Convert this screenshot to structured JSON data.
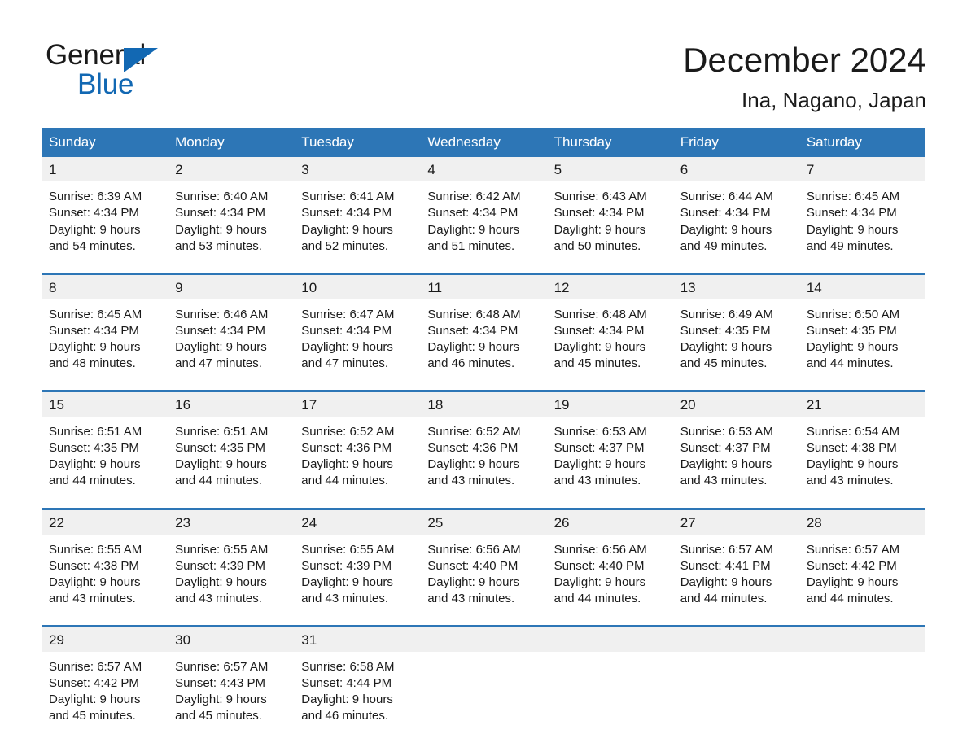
{
  "brand": {
    "name_part1": "General",
    "name_part2": "Blue",
    "accent_color": "#1268b3",
    "header_color": "#2d76b6"
  },
  "header": {
    "title": "December 2024",
    "subtitle": "Ina, Nagano, Japan"
  },
  "weekdays": [
    "Sunday",
    "Monday",
    "Tuesday",
    "Wednesday",
    "Thursday",
    "Friday",
    "Saturday"
  ],
  "weeks": [
    {
      "days": [
        {
          "num": "1",
          "sunrise": "Sunrise: 6:39 AM",
          "sunset": "Sunset: 4:34 PM",
          "daylight_line1": "Daylight: 9 hours",
          "daylight_line2": "and 54 minutes."
        },
        {
          "num": "2",
          "sunrise": "Sunrise: 6:40 AM",
          "sunset": "Sunset: 4:34 PM",
          "daylight_line1": "Daylight: 9 hours",
          "daylight_line2": "and 53 minutes."
        },
        {
          "num": "3",
          "sunrise": "Sunrise: 6:41 AM",
          "sunset": "Sunset: 4:34 PM",
          "daylight_line1": "Daylight: 9 hours",
          "daylight_line2": "and 52 minutes."
        },
        {
          "num": "4",
          "sunrise": "Sunrise: 6:42 AM",
          "sunset": "Sunset: 4:34 PM",
          "daylight_line1": "Daylight: 9 hours",
          "daylight_line2": "and 51 minutes."
        },
        {
          "num": "5",
          "sunrise": "Sunrise: 6:43 AM",
          "sunset": "Sunset: 4:34 PM",
          "daylight_line1": "Daylight: 9 hours",
          "daylight_line2": "and 50 minutes."
        },
        {
          "num": "6",
          "sunrise": "Sunrise: 6:44 AM",
          "sunset": "Sunset: 4:34 PM",
          "daylight_line1": "Daylight: 9 hours",
          "daylight_line2": "and 49 minutes."
        },
        {
          "num": "7",
          "sunrise": "Sunrise: 6:45 AM",
          "sunset": "Sunset: 4:34 PM",
          "daylight_line1": "Daylight: 9 hours",
          "daylight_line2": "and 49 minutes."
        }
      ]
    },
    {
      "days": [
        {
          "num": "8",
          "sunrise": "Sunrise: 6:45 AM",
          "sunset": "Sunset: 4:34 PM",
          "daylight_line1": "Daylight: 9 hours",
          "daylight_line2": "and 48 minutes."
        },
        {
          "num": "9",
          "sunrise": "Sunrise: 6:46 AM",
          "sunset": "Sunset: 4:34 PM",
          "daylight_line1": "Daylight: 9 hours",
          "daylight_line2": "and 47 minutes."
        },
        {
          "num": "10",
          "sunrise": "Sunrise: 6:47 AM",
          "sunset": "Sunset: 4:34 PM",
          "daylight_line1": "Daylight: 9 hours",
          "daylight_line2": "and 47 minutes."
        },
        {
          "num": "11",
          "sunrise": "Sunrise: 6:48 AM",
          "sunset": "Sunset: 4:34 PM",
          "daylight_line1": "Daylight: 9 hours",
          "daylight_line2": "and 46 minutes."
        },
        {
          "num": "12",
          "sunrise": "Sunrise: 6:48 AM",
          "sunset": "Sunset: 4:34 PM",
          "daylight_line1": "Daylight: 9 hours",
          "daylight_line2": "and 45 minutes."
        },
        {
          "num": "13",
          "sunrise": "Sunrise: 6:49 AM",
          "sunset": "Sunset: 4:35 PM",
          "daylight_line1": "Daylight: 9 hours",
          "daylight_line2": "and 45 minutes."
        },
        {
          "num": "14",
          "sunrise": "Sunrise: 6:50 AM",
          "sunset": "Sunset: 4:35 PM",
          "daylight_line1": "Daylight: 9 hours",
          "daylight_line2": "and 44 minutes."
        }
      ]
    },
    {
      "days": [
        {
          "num": "15",
          "sunrise": "Sunrise: 6:51 AM",
          "sunset": "Sunset: 4:35 PM",
          "daylight_line1": "Daylight: 9 hours",
          "daylight_line2": "and 44 minutes."
        },
        {
          "num": "16",
          "sunrise": "Sunrise: 6:51 AM",
          "sunset": "Sunset: 4:35 PM",
          "daylight_line1": "Daylight: 9 hours",
          "daylight_line2": "and 44 minutes."
        },
        {
          "num": "17",
          "sunrise": "Sunrise: 6:52 AM",
          "sunset": "Sunset: 4:36 PM",
          "daylight_line1": "Daylight: 9 hours",
          "daylight_line2": "and 44 minutes."
        },
        {
          "num": "18",
          "sunrise": "Sunrise: 6:52 AM",
          "sunset": "Sunset: 4:36 PM",
          "daylight_line1": "Daylight: 9 hours",
          "daylight_line2": "and 43 minutes."
        },
        {
          "num": "19",
          "sunrise": "Sunrise: 6:53 AM",
          "sunset": "Sunset: 4:37 PM",
          "daylight_line1": "Daylight: 9 hours",
          "daylight_line2": "and 43 minutes."
        },
        {
          "num": "20",
          "sunrise": "Sunrise: 6:53 AM",
          "sunset": "Sunset: 4:37 PM",
          "daylight_line1": "Daylight: 9 hours",
          "daylight_line2": "and 43 minutes."
        },
        {
          "num": "21",
          "sunrise": "Sunrise: 6:54 AM",
          "sunset": "Sunset: 4:38 PM",
          "daylight_line1": "Daylight: 9 hours",
          "daylight_line2": "and 43 minutes."
        }
      ]
    },
    {
      "days": [
        {
          "num": "22",
          "sunrise": "Sunrise: 6:55 AM",
          "sunset": "Sunset: 4:38 PM",
          "daylight_line1": "Daylight: 9 hours",
          "daylight_line2": "and 43 minutes."
        },
        {
          "num": "23",
          "sunrise": "Sunrise: 6:55 AM",
          "sunset": "Sunset: 4:39 PM",
          "daylight_line1": "Daylight: 9 hours",
          "daylight_line2": "and 43 minutes."
        },
        {
          "num": "24",
          "sunrise": "Sunrise: 6:55 AM",
          "sunset": "Sunset: 4:39 PM",
          "daylight_line1": "Daylight: 9 hours",
          "daylight_line2": "and 43 minutes."
        },
        {
          "num": "25",
          "sunrise": "Sunrise: 6:56 AM",
          "sunset": "Sunset: 4:40 PM",
          "daylight_line1": "Daylight: 9 hours",
          "daylight_line2": "and 43 minutes."
        },
        {
          "num": "26",
          "sunrise": "Sunrise: 6:56 AM",
          "sunset": "Sunset: 4:40 PM",
          "daylight_line1": "Daylight: 9 hours",
          "daylight_line2": "and 44 minutes."
        },
        {
          "num": "27",
          "sunrise": "Sunrise: 6:57 AM",
          "sunset": "Sunset: 4:41 PM",
          "daylight_line1": "Daylight: 9 hours",
          "daylight_line2": "and 44 minutes."
        },
        {
          "num": "28",
          "sunrise": "Sunrise: 6:57 AM",
          "sunset": "Sunset: 4:42 PM",
          "daylight_line1": "Daylight: 9 hours",
          "daylight_line2": "and 44 minutes."
        }
      ]
    },
    {
      "days": [
        {
          "num": "29",
          "sunrise": "Sunrise: 6:57 AM",
          "sunset": "Sunset: 4:42 PM",
          "daylight_line1": "Daylight: 9 hours",
          "daylight_line2": "and 45 minutes."
        },
        {
          "num": "30",
          "sunrise": "Sunrise: 6:57 AM",
          "sunset": "Sunset: 4:43 PM",
          "daylight_line1": "Daylight: 9 hours",
          "daylight_line2": "and 45 minutes."
        },
        {
          "num": "31",
          "sunrise": "Sunrise: 6:58 AM",
          "sunset": "Sunset: 4:44 PM",
          "daylight_line1": "Daylight: 9 hours",
          "daylight_line2": "and 46 minutes."
        },
        {
          "num": "",
          "sunrise": "",
          "sunset": "",
          "daylight_line1": "",
          "daylight_line2": ""
        },
        {
          "num": "",
          "sunrise": "",
          "sunset": "",
          "daylight_line1": "",
          "daylight_line2": ""
        },
        {
          "num": "",
          "sunrise": "",
          "sunset": "",
          "daylight_line1": "",
          "daylight_line2": ""
        },
        {
          "num": "",
          "sunrise": "",
          "sunset": "",
          "daylight_line1": "",
          "daylight_line2": ""
        }
      ]
    }
  ]
}
